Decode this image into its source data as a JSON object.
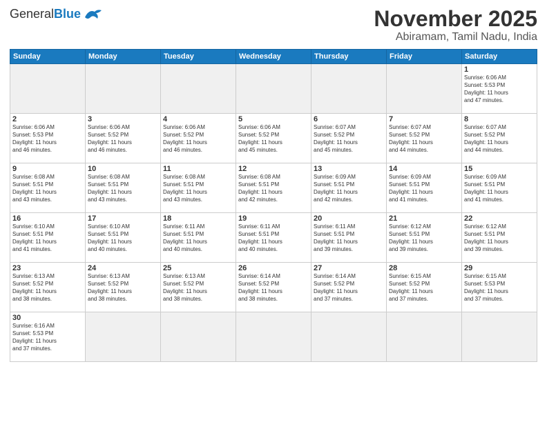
{
  "header": {
    "logo_general": "General",
    "logo_blue": "Blue",
    "month": "November 2025",
    "location": "Abiramam, Tamil Nadu, India"
  },
  "weekdays": [
    "Sunday",
    "Monday",
    "Tuesday",
    "Wednesday",
    "Thursday",
    "Friday",
    "Saturday"
  ],
  "weeks": [
    [
      {
        "day": "",
        "info": ""
      },
      {
        "day": "",
        "info": ""
      },
      {
        "day": "",
        "info": ""
      },
      {
        "day": "",
        "info": ""
      },
      {
        "day": "",
        "info": ""
      },
      {
        "day": "",
        "info": ""
      },
      {
        "day": "1",
        "info": "Sunrise: 6:06 AM\nSunset: 5:53 PM\nDaylight: 11 hours\nand 47 minutes."
      }
    ],
    [
      {
        "day": "2",
        "info": "Sunrise: 6:06 AM\nSunset: 5:53 PM\nDaylight: 11 hours\nand 46 minutes."
      },
      {
        "day": "3",
        "info": "Sunrise: 6:06 AM\nSunset: 5:52 PM\nDaylight: 11 hours\nand 46 minutes."
      },
      {
        "day": "4",
        "info": "Sunrise: 6:06 AM\nSunset: 5:52 PM\nDaylight: 11 hours\nand 46 minutes."
      },
      {
        "day": "5",
        "info": "Sunrise: 6:06 AM\nSunset: 5:52 PM\nDaylight: 11 hours\nand 45 minutes."
      },
      {
        "day": "6",
        "info": "Sunrise: 6:07 AM\nSunset: 5:52 PM\nDaylight: 11 hours\nand 45 minutes."
      },
      {
        "day": "7",
        "info": "Sunrise: 6:07 AM\nSunset: 5:52 PM\nDaylight: 11 hours\nand 44 minutes."
      },
      {
        "day": "8",
        "info": "Sunrise: 6:07 AM\nSunset: 5:52 PM\nDaylight: 11 hours\nand 44 minutes."
      }
    ],
    [
      {
        "day": "9",
        "info": "Sunrise: 6:08 AM\nSunset: 5:51 PM\nDaylight: 11 hours\nand 43 minutes."
      },
      {
        "day": "10",
        "info": "Sunrise: 6:08 AM\nSunset: 5:51 PM\nDaylight: 11 hours\nand 43 minutes."
      },
      {
        "day": "11",
        "info": "Sunrise: 6:08 AM\nSunset: 5:51 PM\nDaylight: 11 hours\nand 43 minutes."
      },
      {
        "day": "12",
        "info": "Sunrise: 6:08 AM\nSunset: 5:51 PM\nDaylight: 11 hours\nand 42 minutes."
      },
      {
        "day": "13",
        "info": "Sunrise: 6:09 AM\nSunset: 5:51 PM\nDaylight: 11 hours\nand 42 minutes."
      },
      {
        "day": "14",
        "info": "Sunrise: 6:09 AM\nSunset: 5:51 PM\nDaylight: 11 hours\nand 41 minutes."
      },
      {
        "day": "15",
        "info": "Sunrise: 6:09 AM\nSunset: 5:51 PM\nDaylight: 11 hours\nand 41 minutes."
      }
    ],
    [
      {
        "day": "16",
        "info": "Sunrise: 6:10 AM\nSunset: 5:51 PM\nDaylight: 11 hours\nand 41 minutes."
      },
      {
        "day": "17",
        "info": "Sunrise: 6:10 AM\nSunset: 5:51 PM\nDaylight: 11 hours\nand 40 minutes."
      },
      {
        "day": "18",
        "info": "Sunrise: 6:11 AM\nSunset: 5:51 PM\nDaylight: 11 hours\nand 40 minutes."
      },
      {
        "day": "19",
        "info": "Sunrise: 6:11 AM\nSunset: 5:51 PM\nDaylight: 11 hours\nand 40 minutes."
      },
      {
        "day": "20",
        "info": "Sunrise: 6:11 AM\nSunset: 5:51 PM\nDaylight: 11 hours\nand 39 minutes."
      },
      {
        "day": "21",
        "info": "Sunrise: 6:12 AM\nSunset: 5:51 PM\nDaylight: 11 hours\nand 39 minutes."
      },
      {
        "day": "22",
        "info": "Sunrise: 6:12 AM\nSunset: 5:51 PM\nDaylight: 11 hours\nand 39 minutes."
      }
    ],
    [
      {
        "day": "23",
        "info": "Sunrise: 6:13 AM\nSunset: 5:52 PM\nDaylight: 11 hours\nand 38 minutes."
      },
      {
        "day": "24",
        "info": "Sunrise: 6:13 AM\nSunset: 5:52 PM\nDaylight: 11 hours\nand 38 minutes."
      },
      {
        "day": "25",
        "info": "Sunrise: 6:13 AM\nSunset: 5:52 PM\nDaylight: 11 hours\nand 38 minutes."
      },
      {
        "day": "26",
        "info": "Sunrise: 6:14 AM\nSunset: 5:52 PM\nDaylight: 11 hours\nand 38 minutes."
      },
      {
        "day": "27",
        "info": "Sunrise: 6:14 AM\nSunset: 5:52 PM\nDaylight: 11 hours\nand 37 minutes."
      },
      {
        "day": "28",
        "info": "Sunrise: 6:15 AM\nSunset: 5:52 PM\nDaylight: 11 hours\nand 37 minutes."
      },
      {
        "day": "29",
        "info": "Sunrise: 6:15 AM\nSunset: 5:53 PM\nDaylight: 11 hours\nand 37 minutes."
      }
    ],
    [
      {
        "day": "30",
        "info": "Sunrise: 6:16 AM\nSunset: 5:53 PM\nDaylight: 11 hours\nand 37 minutes."
      },
      {
        "day": "",
        "info": ""
      },
      {
        "day": "",
        "info": ""
      },
      {
        "day": "",
        "info": ""
      },
      {
        "day": "",
        "info": ""
      },
      {
        "day": "",
        "info": ""
      },
      {
        "day": "",
        "info": ""
      }
    ]
  ]
}
